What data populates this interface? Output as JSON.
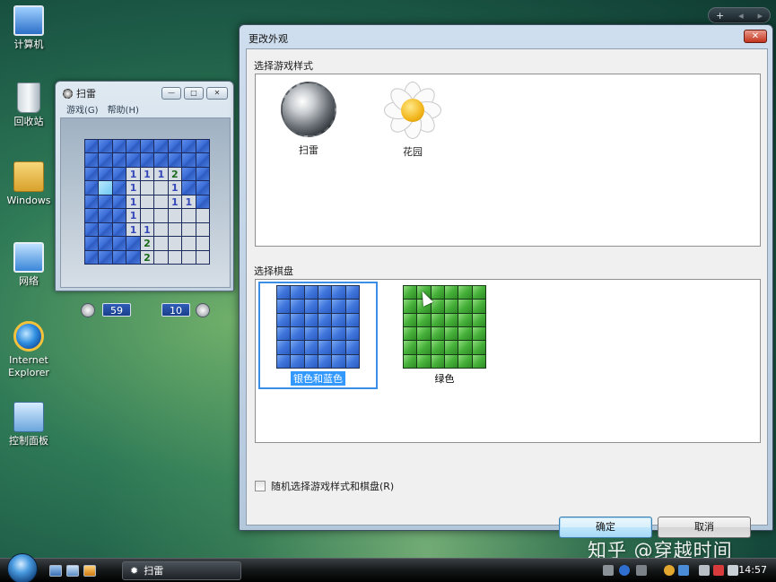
{
  "desktop": {
    "icons": [
      {
        "label": "计算机"
      },
      {
        "label": "回收站"
      },
      {
        "label": "Windows"
      },
      {
        "label": "网络"
      },
      {
        "label": "Internet Explorer"
      },
      {
        "label": "控制面板"
      }
    ],
    "gadget_bar": {
      "add": "+",
      "prev": "◂",
      "next": "▸"
    }
  },
  "minesweeper": {
    "title": "扫雷",
    "menu": [
      "游戏(G)",
      "帮助(H)"
    ],
    "controls": {
      "minimize": "—",
      "maximize": "□",
      "close": "✕"
    },
    "time_value": "59",
    "mines_value": "10",
    "board": [
      [
        "c",
        "c",
        "c",
        "c",
        "c",
        "c",
        "c",
        "c",
        "c"
      ],
      [
        "c",
        "c",
        "c",
        "c",
        "c",
        "c",
        "c",
        "c",
        "c"
      ],
      [
        "c",
        "c",
        "c",
        "1",
        "1",
        "1",
        "2",
        "c",
        "c"
      ],
      [
        "c",
        "h",
        "c",
        "1",
        "o",
        "o",
        "1",
        "c",
        "c"
      ],
      [
        "c",
        "c",
        "c",
        "1",
        "o",
        "o",
        "1",
        "1",
        "c"
      ],
      [
        "c",
        "c",
        "c",
        "1",
        "o",
        "o",
        "o",
        "o",
        "o"
      ],
      [
        "c",
        "c",
        "c",
        "1",
        "1",
        "o",
        "o",
        "o",
        "o"
      ],
      [
        "c",
        "c",
        "c",
        "c",
        "2",
        "o",
        "o",
        "o",
        "o"
      ],
      [
        "c",
        "c",
        "c",
        "c",
        "2",
        "o",
        "o",
        "o",
        "o"
      ]
    ]
  },
  "dialog": {
    "title": "更改外观",
    "close_label": "✕",
    "style_section_label": "选择游戏样式",
    "styles": [
      {
        "label": "扫雷",
        "icon": "mine-icon"
      },
      {
        "label": "花园",
        "icon": "flower-icon"
      }
    ],
    "deck_section_label": "选择棋盘",
    "decks": [
      {
        "label": "银色和蓝色",
        "selected": true,
        "color": "#3f75dc"
      },
      {
        "label": "绿色",
        "selected": false,
        "color": "#46b13a"
      }
    ],
    "random_checkbox_label": "随机选择游戏样式和棋盘(R)",
    "random_checked": false,
    "ok_label": "确定",
    "cancel_label": "取消"
  },
  "watermark": "知乎 @穿越时间",
  "taskbar": {
    "task_label": "扫雷",
    "clock": "14:57"
  }
}
